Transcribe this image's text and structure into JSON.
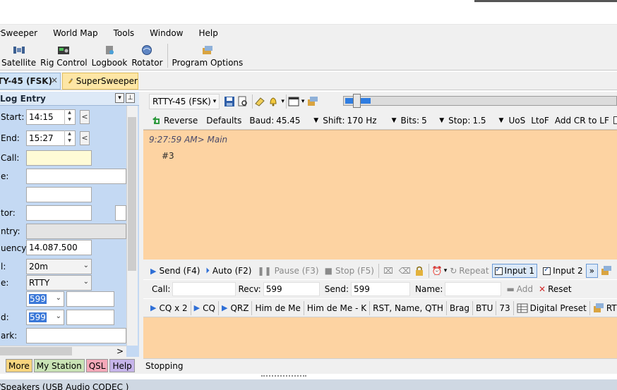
{
  "menu": [
    "rSweeper",
    "World Map",
    "Tools",
    "Window",
    "Help"
  ],
  "toolbar": {
    "items": [
      {
        "label": "Satellite",
        "icon": "satellite-icon"
      },
      {
        "label": "Rig Control",
        "icon": "rig-control-icon"
      },
      {
        "label": "Logbook",
        "icon": "logbook-icon"
      },
      {
        "label": "Rotator",
        "icon": "rotator-icon"
      },
      {
        "label": "Program Options",
        "icon": "program-options-icon"
      }
    ]
  },
  "doc_tabs": {
    "active": "TY-45 (FSK)",
    "close_glyph": "✕",
    "other": "SuperSweeper"
  },
  "log_entry": {
    "title": "Log Entry",
    "start_label": "Start:",
    "start_value": "14:15",
    "end_label": "End:",
    "end_value": "15:27",
    "call_label": "Call:",
    "label_e1": "e:",
    "label_operator": "tor:",
    "label_country": "ntry:",
    "frequency_label": "uency:",
    "frequency_value": "14.087.500",
    "band_label": "l:",
    "band_value": "20m",
    "mode_label": "e:",
    "mode_value": "RTTY",
    "rst_sent_value": "599",
    "rst_rcvd_label": "d:",
    "rst_rcvd_value": "599",
    "remark_label": "ark:",
    "arrow_left": "<",
    "arrow_right": ">"
  },
  "left_tabs": [
    {
      "label": "More",
      "color": "#f7d57e"
    },
    {
      "label": "My Station",
      "color": "#c9e3b5"
    },
    {
      "label": "QSL",
      "color": "#f4a8b8"
    },
    {
      "label": "Help",
      "color": "#c6b4ea"
    }
  ],
  "rtty_toolbar1": {
    "mode": "RTTY-45 (FSK)"
  },
  "rtty_toolbar2": {
    "reverse": "Reverse",
    "defaults": "Defaults",
    "baud_label": "Baud:",
    "baud_value": "45.45",
    "shift_label": "Shift:",
    "shift_value": "170 Hz",
    "bits_label": "Bits:",
    "bits_value": "5",
    "stop_label": "Stop:",
    "stop_value": "1.5",
    "uos": "UoS",
    "ltof": "LtoF",
    "addcr": "Add CR to LF"
  },
  "rx": {
    "line1": "9:27:59 AM> Main",
    "line2": "#3"
  },
  "tx_toolbar": {
    "send": "Send  (F4)",
    "auto": "Auto  (F2)",
    "pause": "Pause  (F3)",
    "stop": "Stop  (F5)",
    "repeat": "Repeat",
    "input1": "Input 1",
    "input2": "Input 2",
    "more": "»"
  },
  "qso_bar": {
    "call_label": "Call:",
    "recv_label": "Recv:",
    "recv_value": "599",
    "send_label": "Send:",
    "send_value": "599",
    "name_label": "Name:",
    "add": "Add",
    "reset": "Reset"
  },
  "macros": [
    "CQ x 2",
    "CQ",
    "QRZ",
    "Him de Me",
    "Him de Me - K",
    "RST, Name, QTH",
    "Brag",
    "BTU",
    "73",
    "Digital Preset",
    "RT"
  ],
  "status": "Stopping",
  "bottom": "/Speakers (USB Audio CODEC )"
}
